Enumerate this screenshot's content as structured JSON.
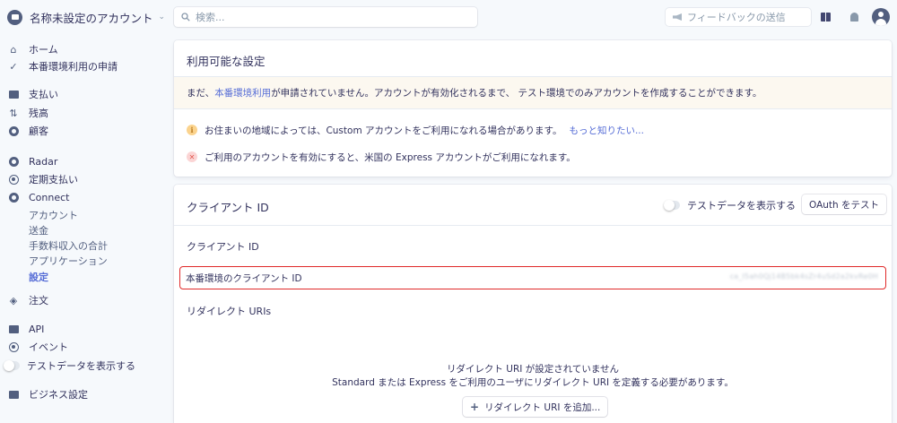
{
  "topbar": {
    "account_name": "名称未設定のアカウント",
    "search_placeholder": "検索...",
    "feedback_label": "フィードバックの送信",
    "icons": [
      "account-icon",
      "chevron-down-icon",
      "search-icon",
      "megaphone-icon",
      "book-icon",
      "bell-icon",
      "user-icon"
    ]
  },
  "sidebar": {
    "home": "ホーム",
    "activate": "本番環境利用の申請",
    "payments": "支払い",
    "balance": "残高",
    "customers": "顧客",
    "radar": "Radar",
    "subscriptions": "定期支払い",
    "connect": "Connect",
    "connect_sub": {
      "accounts": "アカウント",
      "transfers": "送金",
      "fees": "手数料収入の合計",
      "applications": "アプリケーション",
      "settings": "設定"
    },
    "orders": "注文",
    "api": "API",
    "events": "イベント",
    "view_test_data": "テストデータを表示する",
    "business_settings": "ビジネス設定"
  },
  "settings_card": {
    "title": "利用可能な設定",
    "banner_prefix": "まだ、",
    "banner_link": "本番環境利用",
    "banner_suffix": "が申請されていません。アカウントが有効化されるまで、 テスト環境でのみアカウントを作成することができます。",
    "notice_info": "お住まいの地域によっては、Custom アカウントをご利用になれる場合があります。",
    "notice_info_link": "もっと知りたい...",
    "notice_error": "ご利用のアカウントを有効にすると、米国の Express アカウントがご利用になれます。"
  },
  "client_card": {
    "title": "クライアント ID",
    "show_test_data": "テストデータを表示する",
    "oauth_button": "OAuth をテスト",
    "client_id_heading": "クライアント ID",
    "live_client_id_label": "本番環境のクライアント ID",
    "live_client_id_value": "ca_I5ah0Qj14B5bk4sZr4uSd2a2kvRe0H",
    "redirect_heading": "リダイレクト URIs",
    "empty_title": "リダイレクト URI が設定されていません",
    "empty_desc": "Standard または Express をご利用のユーザにリダイレクト URI を定義する必要があります。",
    "add_button": "リダイレクト URI を追加..."
  },
  "colors": {
    "accent": "#556cd6",
    "text": "#32325d",
    "background": "#f6f9fc",
    "highlight": "#e02a2a",
    "warning_bg": "#fcf8f0"
  }
}
